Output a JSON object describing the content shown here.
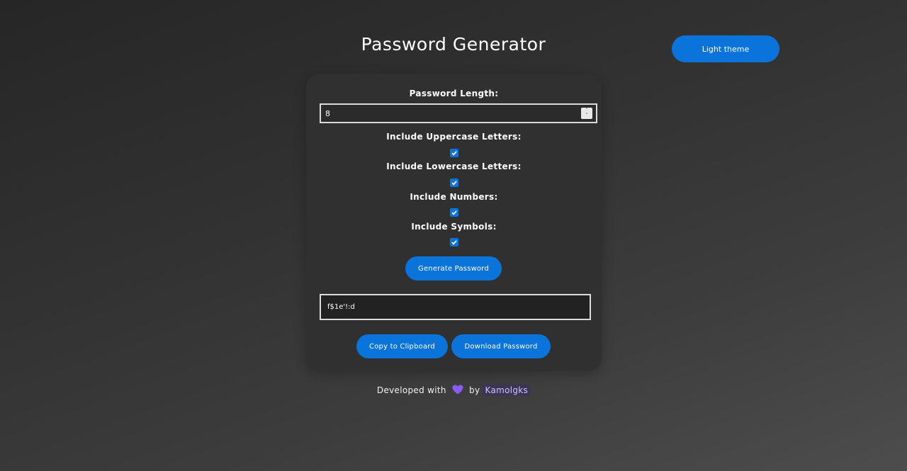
{
  "header": {
    "title": "Password Generator",
    "theme_button_label": "Light theme"
  },
  "form": {
    "length_label": "Password Length:",
    "length_value": "8",
    "uppercase_label": "Include Uppercase Letters:",
    "uppercase_checked": true,
    "lowercase_label": "Include Lowercase Letters:",
    "lowercase_checked": true,
    "numbers_label": "Include Numbers:",
    "numbers_checked": true,
    "symbols_label": "Include Symbols:",
    "symbols_checked": true,
    "generate_label": "Generate Password",
    "output_value": "f$1e'!:d",
    "copy_label": "Copy to Clipboard",
    "download_label": "Download Password"
  },
  "footer": {
    "prefix": "Developed with",
    "by": "by",
    "author": "Kamolgks",
    "heart_icon": "heart-icon"
  },
  "colors": {
    "accent": "#0a74db",
    "heart": "#8a5cf5",
    "author_bg": "#3b3553"
  }
}
